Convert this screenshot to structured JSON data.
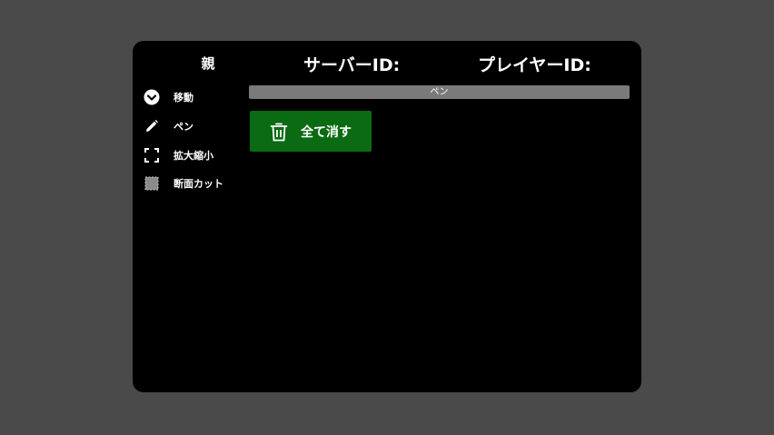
{
  "header": {
    "role": "親",
    "server_id_label": "サーバーID:",
    "player_id_label": "プレイヤーID:"
  },
  "tools": [
    {
      "label": "移動",
      "icon": "move-chevron-icon"
    },
    {
      "label": "ペン",
      "icon": "pencil-icon"
    },
    {
      "label": "拡大縮小",
      "icon": "zoom-expand-icon"
    },
    {
      "label": "断面カット",
      "icon": "section-cut-icon"
    }
  ],
  "mode_bar": {
    "current_mode": "ペン"
  },
  "clear_button": {
    "label": "全て消す",
    "icon": "trash-icon"
  },
  "colors": {
    "background": "#4a4a4a",
    "panel": "#000000",
    "mode_bar": "#7a7a7a",
    "clear_button": "#0b6b12"
  }
}
